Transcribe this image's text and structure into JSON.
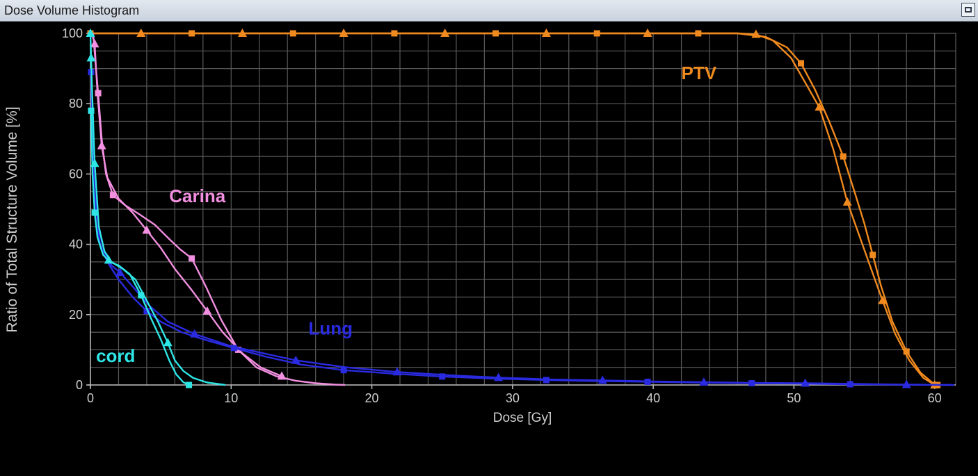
{
  "window": {
    "title": "Dose Volume Histogram",
    "restore_icon": "window-restore-icon"
  },
  "chart_data": {
    "type": "line",
    "xlabel": "Dose [Gy]",
    "ylabel": "Ratio of Total Structure Volume [%]",
    "xlim": [
      0,
      61.5
    ],
    "ylim": [
      0,
      100
    ],
    "xticks": [
      0,
      10,
      20,
      30,
      40,
      50,
      60
    ],
    "yticks": [
      0,
      20,
      40,
      60,
      80,
      100
    ],
    "x_tick_labels": [
      "0",
      "10",
      "20",
      "30",
      "40",
      "50",
      "60"
    ],
    "y_tick_labels": [
      "0",
      "20",
      "40",
      "60",
      "80",
      "100"
    ],
    "grid": true,
    "background": "#000000",
    "grid_color": "#5a5a5a",
    "annotations": [
      {
        "text": "PTV",
        "x": 42,
        "y": 87,
        "color": "#f08a1e"
      },
      {
        "text": "Carina",
        "x": 5.6,
        "y": 52,
        "color": "#f28fe0"
      },
      {
        "text": "Lung",
        "x": 15.5,
        "y": 14.3,
        "color": "#2a2ae0"
      },
      {
        "text": "cord",
        "x": 0.4,
        "y": 6.5,
        "color": "#2ee6e6"
      }
    ],
    "series": [
      {
        "color": "#f08a1e",
        "marker": "square",
        "x": [
          0,
          7.2,
          14.4,
          21.6,
          28.8,
          36,
          43.2,
          46,
          48,
          49.5,
          50.5,
          51.5,
          52.5,
          53.5,
          54.3,
          55,
          55.6,
          56.2,
          57,
          58,
          59,
          59.8,
          60.2
        ],
        "y": [
          100,
          100,
          100,
          100,
          100,
          100,
          100,
          100,
          99,
          96,
          91.5,
          84,
          75,
          65,
          55,
          46,
          37,
          28,
          18,
          9.5,
          3.5,
          0.8,
          0
        ],
        "markers_x": [
          0,
          7.2,
          14.4,
          21.6,
          28.8,
          36,
          43.2,
          50.5,
          53.5,
          55.6,
          58,
          60.2
        ],
        "markers_y": [
          100,
          100,
          100,
          100,
          100,
          100,
          100,
          91.5,
          65,
          37,
          9.5,
          0
        ]
      },
      {
        "color": "#f08a1e",
        "marker": "triangle",
        "x": [
          0,
          3.6,
          10.8,
          18,
          25.2,
          32.4,
          39.6,
          46,
          47.3,
          48.5,
          49.8,
          50.8,
          51.8,
          52.8,
          53.8,
          54.6,
          55.4,
          56.3,
          57.2,
          58.2,
          59.2,
          60
        ],
        "y": [
          100,
          100,
          100,
          100,
          100,
          100,
          100,
          100,
          99.7,
          98,
          93,
          86,
          79,
          67,
          52,
          43,
          34,
          24,
          14.5,
          7,
          2,
          0
        ],
        "markers_x": [
          3.6,
          10.8,
          18,
          25.2,
          32.4,
          39.6,
          47.3,
          51.8,
          53.8,
          56.3,
          60
        ],
        "markers_y": [
          100,
          100,
          100,
          100,
          100,
          100,
          99.7,
          79,
          52,
          24,
          0
        ]
      },
      {
        "color": "#f28fe0",
        "marker": "square",
        "x": [
          0.2,
          0.35,
          0.55,
          0.8,
          1.1,
          1.6,
          2.5,
          3.5,
          4.6,
          5.6,
          6.4,
          7.2,
          8.2,
          9.3,
          10.5,
          11.8,
          13.2,
          14.6,
          16,
          17.4,
          18.1
        ],
        "y": [
          100,
          92,
          83,
          70,
          60,
          54,
          51,
          48.5,
          45.5,
          41.5,
          38.5,
          36,
          28,
          18.5,
          10,
          5,
          2.5,
          1.2,
          0.5,
          0.1,
          0
        ],
        "markers_x": [
          0.55,
          1.6,
          7.2,
          10.5
        ],
        "markers_y": [
          83,
          54,
          36,
          10
        ]
      },
      {
        "color": "#f28fe0",
        "marker": "triangle",
        "x": [
          0.1,
          0.3,
          0.5,
          0.8,
          1.2,
          2,
          3,
          4,
          5,
          6,
          7.2,
          8.3,
          9.4,
          10.8,
          12.1,
          13.6
        ],
        "y": [
          100,
          97,
          83,
          68,
          59,
          53,
          49,
          44,
          39,
          33,
          27,
          21,
          15,
          9,
          5,
          2.5
        ],
        "markers_x": [
          0.3,
          0.8,
          4,
          8.3,
          13.6
        ],
        "markers_y": [
          97,
          68,
          44,
          21,
          2.5
        ]
      },
      {
        "color": "#2a2ae0",
        "marker": "square",
        "x": [
          0.05,
          0.2,
          0.4,
          0.7,
          1.2,
          2,
          3,
          4,
          5,
          6.5,
          8,
          10.2,
          12.5,
          15,
          18,
          21.6,
          25,
          28.8,
          32.4,
          36,
          39.6,
          43.2,
          47,
          50.4,
          54,
          57.6,
          61.2
        ],
        "y": [
          89,
          60,
          46,
          40,
          35,
          30,
          25,
          21,
          18,
          15,
          13,
          10.5,
          8,
          5.8,
          4.2,
          3.2,
          2.4,
          1.8,
          1.4,
          1.1,
          0.9,
          0.7,
          0.5,
          0.4,
          0.2,
          0.1,
          0
        ],
        "markers_x": [
          0.05,
          4,
          10.2,
          18,
          25,
          32.4,
          39.6,
          47,
          54
        ],
        "markers_y": [
          89,
          21,
          10.5,
          4.2,
          2.4,
          1.4,
          0.9,
          0.5,
          0.2
        ]
      },
      {
        "color": "#2a2ae0",
        "marker": "triangle",
        "x": [
          0.1,
          0.3,
          0.6,
          1,
          1.5,
          2.1,
          3,
          4.2,
          5.5,
          7.4,
          10,
          14.6,
          18.2,
          21.8,
          25.4,
          29,
          32.6,
          36.4,
          40,
          43.6,
          47.2,
          50.8,
          54.4,
          58,
          61.4
        ],
        "y": [
          74,
          55,
          44,
          38,
          34,
          32,
          28,
          22.5,
          18,
          14.5,
          11,
          7,
          5,
          3.7,
          2.8,
          2.1,
          1.6,
          1.3,
          1,
          0.8,
          0.6,
          0.5,
          0.3,
          0.1,
          0
        ],
        "markers_x": [
          2.1,
          7.4,
          14.6,
          21.8,
          29,
          36.4,
          43.6,
          50.8,
          58
        ],
        "markers_y": [
          32,
          14.5,
          7,
          3.7,
          2.1,
          1.3,
          0.8,
          0.5,
          0.1
        ]
      },
      {
        "color": "#2ee6e6",
        "marker": "square",
        "x": [
          0.05,
          0.15,
          0.3,
          0.5,
          0.9,
          1.4,
          2,
          2.8,
          3.6,
          4.3,
          5,
          5.6,
          6.1,
          6.6,
          7
        ],
        "y": [
          78,
          60,
          49,
          42,
          37,
          35,
          34,
          31.5,
          25.5,
          19,
          13,
          7,
          3,
          0.8,
          0
        ],
        "markers_x": [
          0.05,
          0.3,
          3.6,
          7
        ],
        "markers_y": [
          78,
          49,
          25.5,
          0
        ]
      },
      {
        "color": "#2ee6e6",
        "marker": "triangle",
        "x": [
          0,
          0.05,
          0.15,
          0.3,
          0.6,
          1,
          1.5,
          2.3,
          3.2,
          4,
          4.8,
          5.5,
          6,
          6.6,
          7.3,
          8.3,
          9.6
        ],
        "y": [
          100,
          93,
          80,
          63,
          45,
          38,
          35,
          33,
          30,
          24,
          18,
          12,
          7,
          4,
          2,
          0.7,
          0
        ],
        "markers_x": [
          0,
          0.05,
          0.3,
          1.3,
          5.5
        ],
        "markers_y": [
          100,
          93,
          63,
          35.5,
          12
        ]
      }
    ]
  }
}
